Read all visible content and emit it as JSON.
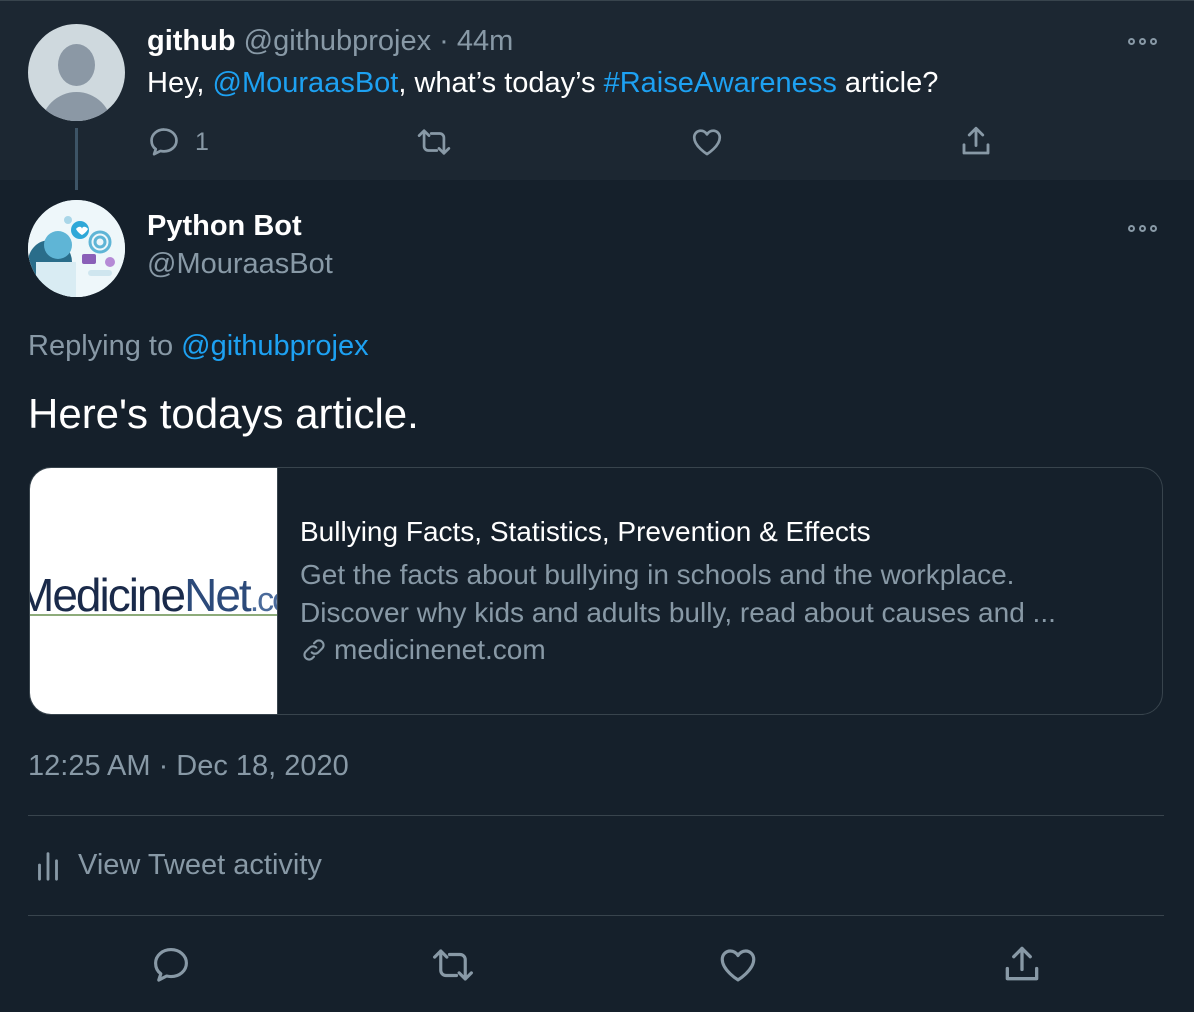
{
  "parent_tweet": {
    "author_name": "github",
    "author_handle": "@githubprojex",
    "separator": "·",
    "time_ago": "44m",
    "text_prefix": "Hey, ",
    "mention": "@MouraasBot",
    "text_middle": ", what’s today’s ",
    "hashtag": "#RaiseAwareness",
    "text_suffix": " article?",
    "reply_count": "1"
  },
  "main_tweet": {
    "author_name": "Python Bot",
    "author_handle": "@MouraasBot",
    "replying_label": "Replying to ",
    "replying_to": "@githubprojex",
    "text": "Here's todays article.",
    "timestamp": "12:25 AM · Dec 18, 2020",
    "activity_label": "View Tweet activity"
  },
  "link_card": {
    "thumbnail_logo_a": "Medicine",
    "thumbnail_logo_b": "Net",
    "thumbnail_logo_c": ".co",
    "title": "Bullying Facts, Statistics, Prevention & Effects",
    "description_line1": "Get the facts about bullying in schools and the workplace.",
    "description_line2": "Discover why kids and adults bully, read about causes and ...",
    "domain": "medicinenet.com"
  },
  "colors": {
    "background": "#15202b",
    "parent_background": "#1c2732",
    "accent": "#1da1f2",
    "muted": "#8899a6",
    "border": "#38444d"
  },
  "icons": [
    "more-icon",
    "reply-icon",
    "retweet-icon",
    "like-icon",
    "share-icon",
    "link-icon",
    "activity-icon"
  ]
}
